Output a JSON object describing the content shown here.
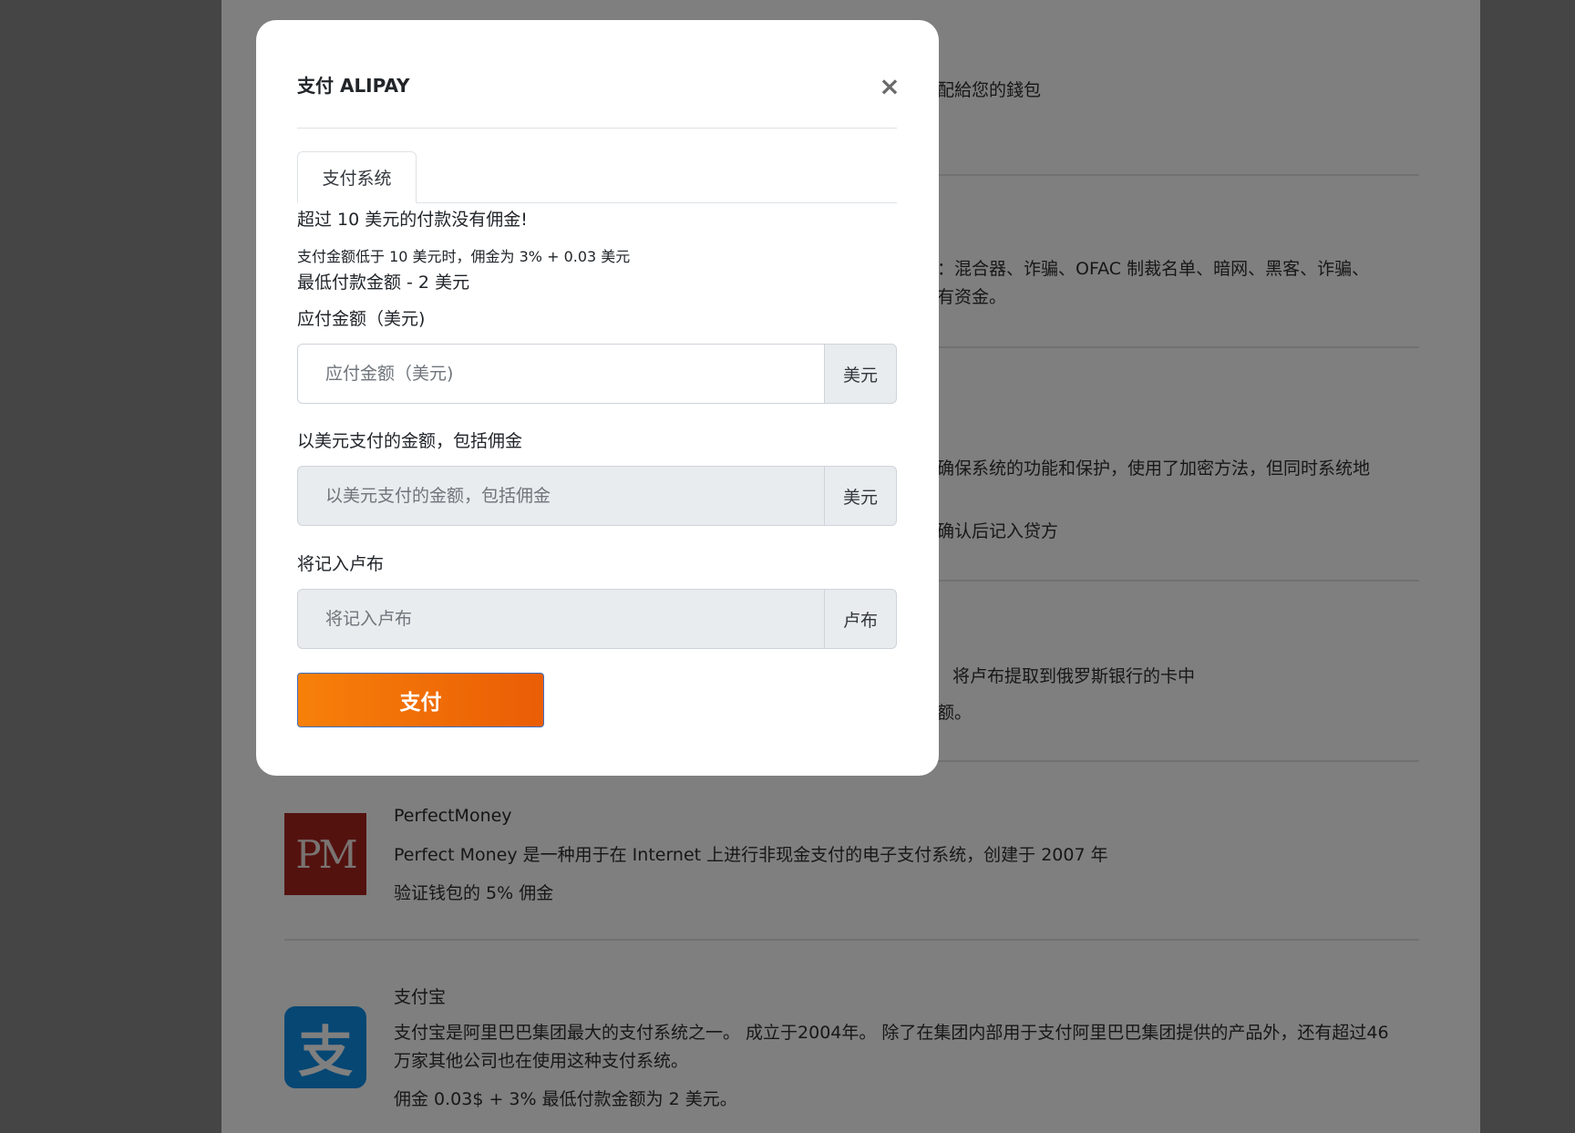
{
  "modal": {
    "title": "支付 ALIPAY",
    "close_symbol": "×",
    "tab_label": "支付系统",
    "no_commission_notice": "超过 10 美元的付款没有佣金!",
    "commission_note": "支付金额低于 10 美元时，佣金为 3% + 0.03 美元",
    "min_amount_note": "最低付款金额 - 2 美元",
    "amount_label": "应付金额（美元)",
    "amount_placeholder": "应付金额（美元)",
    "amount_value": "",
    "amount_currency": "美元",
    "total_label": "以美元支付的金额，包括佣金",
    "total_placeholder": "以美元支付的金额，包括佣金",
    "total_value": "",
    "total_currency": "美元",
    "rub_label": "将记入卢布",
    "rub_placeholder": "将记入卢布",
    "rub_value": "",
    "rub_currency": "卢布",
    "pay_button_label": "支付"
  },
  "background": {
    "fragments": {
      "wallet": "配給您的錢包",
      "aml_line1": "：混合器、诈骗、OFAC 制裁名单、暗网、黑客、诈骗、",
      "aml_line2": "有资金。",
      "security_line1": "确保系统的功能和保护，使用了加密方法，但同时系统地",
      "security_line2": "确认后记入贷方",
      "card_line1": "将卢布提取到俄罗斯银行的卡中",
      "card_line2": "额。"
    },
    "payment_methods": [
      {
        "name": "PerfectMoney",
        "logo_text": "PM",
        "description": "Perfect Money 是一种用于在 Internet 上进行非现金支付的电子支付系统，创建于 2007 年",
        "fee": "验证钱包的 5% 佣金"
      },
      {
        "name": "支付宝",
        "logo_text": "支",
        "description": "支付宝是阿里巴巴集团最大的支付系统之一。 成立于2004年。 除了在集团内部用于支付阿里巴巴集团提供的产品外，还有超过46万家其他公司也在使用这种支付系统。",
        "fee": "佣金 0.03$ + 3% 最低付款金额为 2 美元。"
      }
    ]
  },
  "colors": {
    "overlay": "rgba(0,0,0,0.5)",
    "pay_button_start": "#f7800a",
    "pay_button_end": "#ea5d05",
    "perfectmoney_logo": "#a8251e",
    "alipay_logo": "#0c8ee8"
  },
  "icons": {
    "close": "close-icon",
    "perfectmoney": "perfectmoney-logo",
    "alipay": "alipay-logo"
  }
}
